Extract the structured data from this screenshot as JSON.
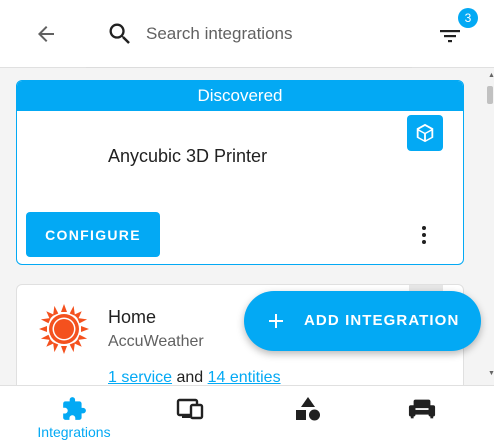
{
  "header": {
    "back_icon": "arrow-left-icon",
    "search_icon": "search-icon",
    "search_placeholder": "Search integrations",
    "search_value": "",
    "filter_icon": "filter-icon",
    "filter_badge": "3"
  },
  "discovered_card": {
    "header": "Discovered",
    "badge_icon": "cube-icon",
    "title": "Anycubic 3D Printer",
    "configure_label": "CONFIGURE",
    "more_icon": "more-vertical-icon"
  },
  "home_card": {
    "logo_icon": "sun-icon",
    "title": "Home",
    "subtitle": "AccuWeather",
    "services_link": "1 service",
    "and_text": " and ",
    "entities_link": "14 entities"
  },
  "fab": {
    "icon": "plus-icon",
    "label": "ADD INTEGRATION"
  },
  "tabs": [
    {
      "label": "Integrations",
      "icon": "puzzle-icon",
      "active": true
    },
    {
      "label": "",
      "icon": "devices-icon",
      "active": false
    },
    {
      "label": "",
      "icon": "shapes-icon",
      "active": false
    },
    {
      "label": "",
      "icon": "sofa-icon",
      "active": false
    }
  ],
  "colors": {
    "accent": "#03a9f4",
    "text": "#212121",
    "secondary_text": "#616161",
    "sun": "#f4511e"
  }
}
